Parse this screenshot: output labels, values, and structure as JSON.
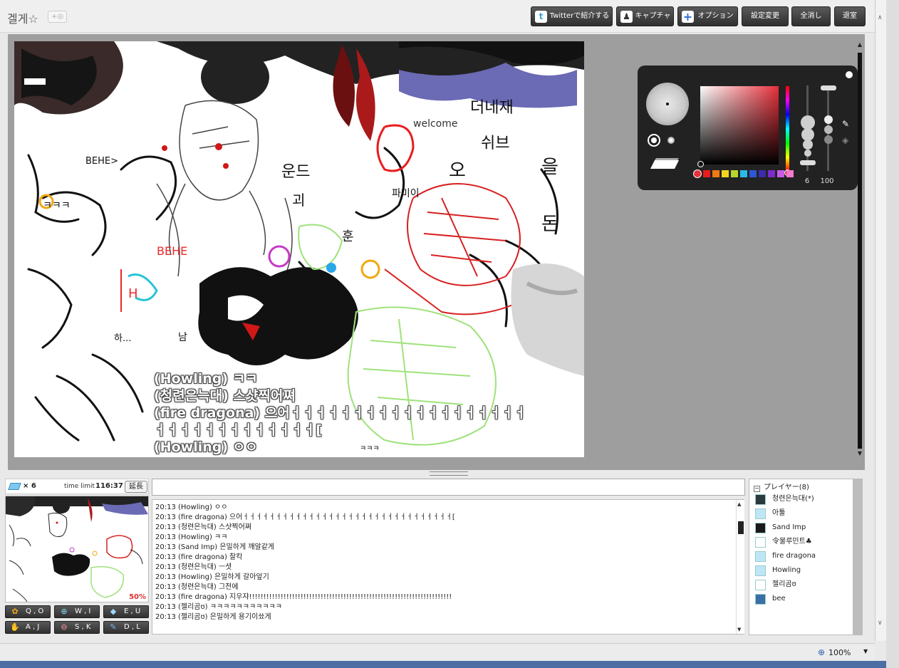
{
  "header": {
    "room_title": "겔게☆",
    "room_add": "+◎",
    "buttons": {
      "twitter": "Twitterで紹介する",
      "capture": "キャプチャ",
      "option": "オプション",
      "settings": "設定変更",
      "clear": "全消し",
      "exit": "退室"
    }
  },
  "canvas_chat": [
    "(Howling) ㅋㅋ",
    "(청련은늑대) 스샷찍어쪄",
    "(fire dragona) 으어ㅓㅓㅓㅓㅓㅓㅓㅓㅓㅓㅓㅓㅓㅓㅓㅓㅓㅓㅓ",
    "ㅓㅓㅓㅓㅓㅓㅓㅓㅓㅓㅓㅓㅓ[",
    "(Howling) ㅇㅇ"
  ],
  "color_panel": {
    "size_value": "6",
    "alpha_value": "100",
    "current_color": "#e8303a",
    "swatches": [
      "#e81c1c",
      "#f07a12",
      "#f2d51a",
      "#b8d62a",
      "#2bb9e8",
      "#2c58d6",
      "#3b2ca8",
      "#7a2cc8",
      "#c85ce8",
      "#f27ad0"
    ]
  },
  "thumb": {
    "layer_count": "× 6",
    "time_label": "time limit",
    "time_value": "116:37",
    "extend": "延長",
    "zoom": "50%"
  },
  "tools": [
    {
      "label": "Q , O",
      "icon": "palette-icon"
    },
    {
      "label": "W , I",
      "icon": "zoom-in-icon"
    },
    {
      "label": "E , U",
      "icon": "eraser-icon"
    },
    {
      "label": "A , J",
      "icon": "hand-icon"
    },
    {
      "label": "S , K",
      "icon": "zoom-out-icon"
    },
    {
      "label": "D , L",
      "icon": "pen-icon"
    }
  ],
  "chat": [
    "20:13 (Howling) ㅇㅇ",
    "20:13 (fire dragona) 으어ㅓㅓㅓㅓㅓㅓㅓㅓㅓㅓㅓㅓㅓㅓㅓㅓㅓㅓㅓㅓㅓㅓㅓㅓㅓㅓㅓㅓㅓㅓㅓㅓ[",
    "20:13 (청련은늑대) 스샷찍어쪄",
    "20:13 (Howling) ㅋㅋ",
    "20:13 (Sand Imp) 은밀하게 깨알같게",
    "20:13 (fire dragona) 찰칵",
    "20:13 (청련은늑대) ㅡ셧",
    "20:13 (Howling) 은밀하게 갈아엎기",
    "20:13 (청련은늑대) 그전에",
    "20:13 (fire dragona) 지우쟈!!!!!!!!!!!!!!!!!!!!!!!!!!!!!!!!!!!!!!!!!!!!!!!!!!!!!!!!!!!!!!!!!!!!!!!",
    "20:13 (젤리곰ʊ) ㅋㅋㅋㅋㅋㅋㅋㅋㅋㅋㅋ",
    "20:13 (젤리곰ʊ) 은밀하게 용기이쑈게"
  ],
  "players": {
    "header": "プレイヤー(8)",
    "list": [
      {
        "name": "청련은늑대(*)",
        "avatar": "#2b3a3c"
      },
      {
        "name": "아툴",
        "avatar": "#bfe6f7"
      },
      {
        "name": "Sand Imp",
        "avatar": "#1a1a1a"
      },
      {
        "name": "令불루민트♣",
        "avatar": "#ffffff"
      },
      {
        "name": "fire dragona",
        "avatar": "#bfe6f7"
      },
      {
        "name": "Howling",
        "avatar": "#bfe6f7"
      },
      {
        "name": "젤리곰ʊ",
        "avatar": "#ffffff"
      },
      {
        "name": "bee",
        "avatar": "#3b6fa8"
      }
    ]
  },
  "status": {
    "zoom": "100%"
  }
}
